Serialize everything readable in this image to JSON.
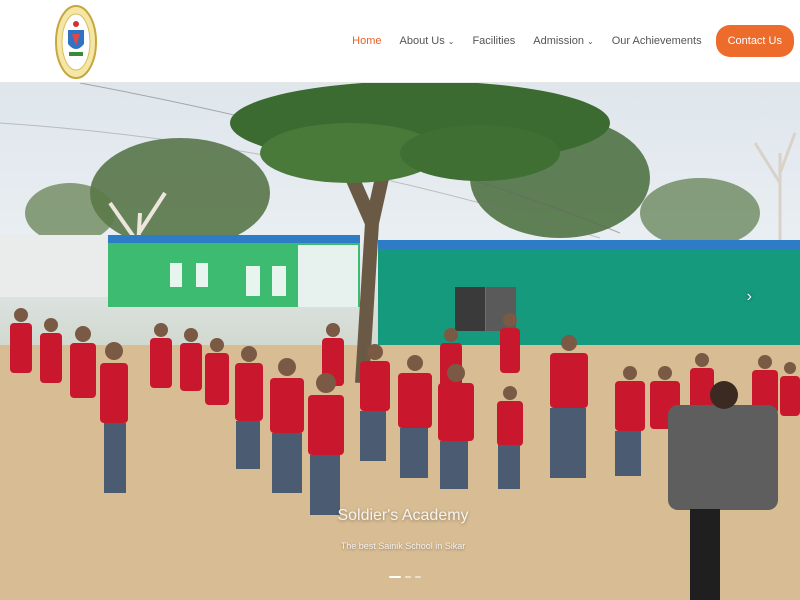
{
  "header": {
    "logo_text": "SOLDIER'S ACADEMY SIKAR",
    "nav": [
      {
        "label": "Home",
        "active": true,
        "has_dropdown": false
      },
      {
        "label": "About Us",
        "active": false,
        "has_dropdown": true
      },
      {
        "label": "Facilities",
        "active": false,
        "has_dropdown": false
      },
      {
        "label": "Admission",
        "active": false,
        "has_dropdown": true
      },
      {
        "label": "Our Achievements",
        "active": false,
        "has_dropdown": false
      }
    ],
    "contact_label": "Contact Us",
    "accent_color": "#ee6c2b"
  },
  "hero": {
    "caption_title": "Soldier's Academy",
    "caption_subtitle": "The best Sainik School in Sikar",
    "next_icon": "chevron-right-icon",
    "slides": 3,
    "active_slide": 1
  }
}
